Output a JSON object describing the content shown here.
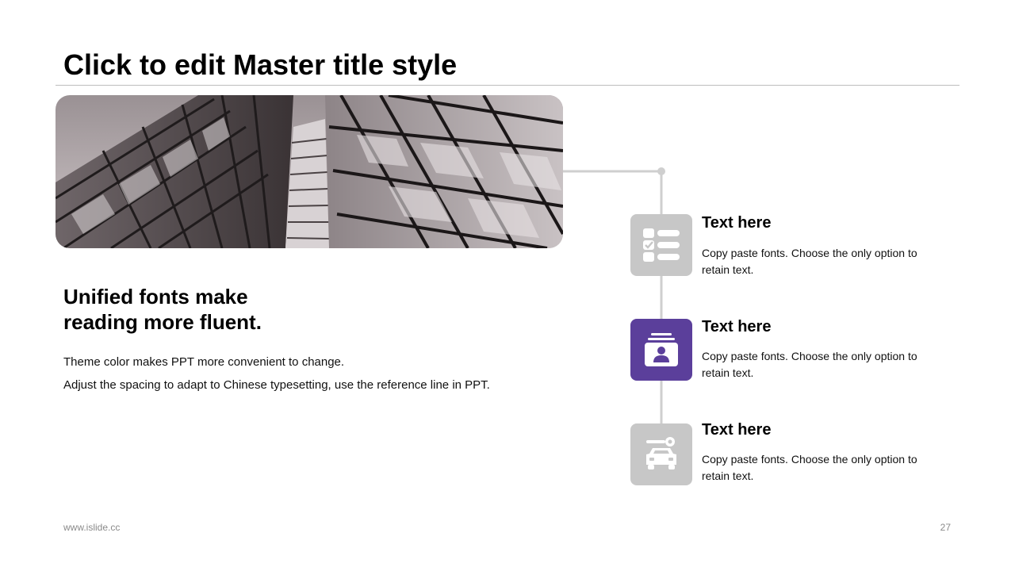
{
  "slide": {
    "title": "Click to edit Master title style",
    "accent_color": "#5b3f9b",
    "neutral_color": "#c7c7c7"
  },
  "left": {
    "photo_subject": "building-facade-photo",
    "heading_line1": "Unified fonts make",
    "heading_line2": "reading more fluent.",
    "body_line1": "Theme color makes PPT more convenient to change.",
    "body_line2": "Adjust the spacing to adapt to Chinese typesetting, use the reference line in PPT."
  },
  "items": [
    {
      "icon": "checklist-icon",
      "title": "Text here",
      "desc": "Copy paste fonts. Choose the only option to retain text."
    },
    {
      "icon": "id-card-icon",
      "title": "Text here",
      "desc": "Copy paste fonts. Choose the only option to retain text."
    },
    {
      "icon": "car-key-icon",
      "title": "Text here",
      "desc": "Copy paste fonts. Choose the only option to retain text."
    }
  ],
  "footer": {
    "website": "www.islide.cc",
    "page_number": "27"
  }
}
